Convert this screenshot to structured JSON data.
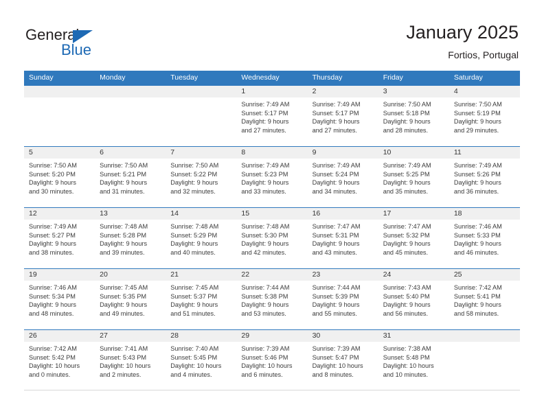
{
  "brand": {
    "name_primary": "General",
    "name_secondary": "Blue",
    "accent_color": "#1d69b4"
  },
  "header": {
    "title": "January 2025",
    "subtitle": "Fortios, Portugal"
  },
  "theme": {
    "header_blue": "#3079bd",
    "daynum_band": "#f0f0f0",
    "text": "#231f20"
  },
  "weekdays": [
    "Sunday",
    "Monday",
    "Tuesday",
    "Wednesday",
    "Thursday",
    "Friday",
    "Saturday"
  ],
  "weeks": [
    [
      {
        "day": "",
        "sunrise": "",
        "sunset": "",
        "daylight_line1": "",
        "daylight_line2": ""
      },
      {
        "day": "",
        "sunrise": "",
        "sunset": "",
        "daylight_line1": "",
        "daylight_line2": ""
      },
      {
        "day": "",
        "sunrise": "",
        "sunset": "",
        "daylight_line1": "",
        "daylight_line2": ""
      },
      {
        "day": "1",
        "sunrise": "Sunrise: 7:49 AM",
        "sunset": "Sunset: 5:17 PM",
        "daylight_line1": "Daylight: 9 hours",
        "daylight_line2": "and 27 minutes."
      },
      {
        "day": "2",
        "sunrise": "Sunrise: 7:49 AM",
        "sunset": "Sunset: 5:17 PM",
        "daylight_line1": "Daylight: 9 hours",
        "daylight_line2": "and 27 minutes."
      },
      {
        "day": "3",
        "sunrise": "Sunrise: 7:50 AM",
        "sunset": "Sunset: 5:18 PM",
        "daylight_line1": "Daylight: 9 hours",
        "daylight_line2": "and 28 minutes."
      },
      {
        "day": "4",
        "sunrise": "Sunrise: 7:50 AM",
        "sunset": "Sunset: 5:19 PM",
        "daylight_line1": "Daylight: 9 hours",
        "daylight_line2": "and 29 minutes."
      }
    ],
    [
      {
        "day": "5",
        "sunrise": "Sunrise: 7:50 AM",
        "sunset": "Sunset: 5:20 PM",
        "daylight_line1": "Daylight: 9 hours",
        "daylight_line2": "and 30 minutes."
      },
      {
        "day": "6",
        "sunrise": "Sunrise: 7:50 AM",
        "sunset": "Sunset: 5:21 PM",
        "daylight_line1": "Daylight: 9 hours",
        "daylight_line2": "and 31 minutes."
      },
      {
        "day": "7",
        "sunrise": "Sunrise: 7:50 AM",
        "sunset": "Sunset: 5:22 PM",
        "daylight_line1": "Daylight: 9 hours",
        "daylight_line2": "and 32 minutes."
      },
      {
        "day": "8",
        "sunrise": "Sunrise: 7:49 AM",
        "sunset": "Sunset: 5:23 PM",
        "daylight_line1": "Daylight: 9 hours",
        "daylight_line2": "and 33 minutes."
      },
      {
        "day": "9",
        "sunrise": "Sunrise: 7:49 AM",
        "sunset": "Sunset: 5:24 PM",
        "daylight_line1": "Daylight: 9 hours",
        "daylight_line2": "and 34 minutes."
      },
      {
        "day": "10",
        "sunrise": "Sunrise: 7:49 AM",
        "sunset": "Sunset: 5:25 PM",
        "daylight_line1": "Daylight: 9 hours",
        "daylight_line2": "and 35 minutes."
      },
      {
        "day": "11",
        "sunrise": "Sunrise: 7:49 AM",
        "sunset": "Sunset: 5:26 PM",
        "daylight_line1": "Daylight: 9 hours",
        "daylight_line2": "and 36 minutes."
      }
    ],
    [
      {
        "day": "12",
        "sunrise": "Sunrise: 7:49 AM",
        "sunset": "Sunset: 5:27 PM",
        "daylight_line1": "Daylight: 9 hours",
        "daylight_line2": "and 38 minutes."
      },
      {
        "day": "13",
        "sunrise": "Sunrise: 7:48 AM",
        "sunset": "Sunset: 5:28 PM",
        "daylight_line1": "Daylight: 9 hours",
        "daylight_line2": "and 39 minutes."
      },
      {
        "day": "14",
        "sunrise": "Sunrise: 7:48 AM",
        "sunset": "Sunset: 5:29 PM",
        "daylight_line1": "Daylight: 9 hours",
        "daylight_line2": "and 40 minutes."
      },
      {
        "day": "15",
        "sunrise": "Sunrise: 7:48 AM",
        "sunset": "Sunset: 5:30 PM",
        "daylight_line1": "Daylight: 9 hours",
        "daylight_line2": "and 42 minutes."
      },
      {
        "day": "16",
        "sunrise": "Sunrise: 7:47 AM",
        "sunset": "Sunset: 5:31 PM",
        "daylight_line1": "Daylight: 9 hours",
        "daylight_line2": "and 43 minutes."
      },
      {
        "day": "17",
        "sunrise": "Sunrise: 7:47 AM",
        "sunset": "Sunset: 5:32 PM",
        "daylight_line1": "Daylight: 9 hours",
        "daylight_line2": "and 45 minutes."
      },
      {
        "day": "18",
        "sunrise": "Sunrise: 7:46 AM",
        "sunset": "Sunset: 5:33 PM",
        "daylight_line1": "Daylight: 9 hours",
        "daylight_line2": "and 46 minutes."
      }
    ],
    [
      {
        "day": "19",
        "sunrise": "Sunrise: 7:46 AM",
        "sunset": "Sunset: 5:34 PM",
        "daylight_line1": "Daylight: 9 hours",
        "daylight_line2": "and 48 minutes."
      },
      {
        "day": "20",
        "sunrise": "Sunrise: 7:45 AM",
        "sunset": "Sunset: 5:35 PM",
        "daylight_line1": "Daylight: 9 hours",
        "daylight_line2": "and 49 minutes."
      },
      {
        "day": "21",
        "sunrise": "Sunrise: 7:45 AM",
        "sunset": "Sunset: 5:37 PM",
        "daylight_line1": "Daylight: 9 hours",
        "daylight_line2": "and 51 minutes."
      },
      {
        "day": "22",
        "sunrise": "Sunrise: 7:44 AM",
        "sunset": "Sunset: 5:38 PM",
        "daylight_line1": "Daylight: 9 hours",
        "daylight_line2": "and 53 minutes."
      },
      {
        "day": "23",
        "sunrise": "Sunrise: 7:44 AM",
        "sunset": "Sunset: 5:39 PM",
        "daylight_line1": "Daylight: 9 hours",
        "daylight_line2": "and 55 minutes."
      },
      {
        "day": "24",
        "sunrise": "Sunrise: 7:43 AM",
        "sunset": "Sunset: 5:40 PM",
        "daylight_line1": "Daylight: 9 hours",
        "daylight_line2": "and 56 minutes."
      },
      {
        "day": "25",
        "sunrise": "Sunrise: 7:42 AM",
        "sunset": "Sunset: 5:41 PM",
        "daylight_line1": "Daylight: 9 hours",
        "daylight_line2": "and 58 minutes."
      }
    ],
    [
      {
        "day": "26",
        "sunrise": "Sunrise: 7:42 AM",
        "sunset": "Sunset: 5:42 PM",
        "daylight_line1": "Daylight: 10 hours",
        "daylight_line2": "and 0 minutes."
      },
      {
        "day": "27",
        "sunrise": "Sunrise: 7:41 AM",
        "sunset": "Sunset: 5:43 PM",
        "daylight_line1": "Daylight: 10 hours",
        "daylight_line2": "and 2 minutes."
      },
      {
        "day": "28",
        "sunrise": "Sunrise: 7:40 AM",
        "sunset": "Sunset: 5:45 PM",
        "daylight_line1": "Daylight: 10 hours",
        "daylight_line2": "and 4 minutes."
      },
      {
        "day": "29",
        "sunrise": "Sunrise: 7:39 AM",
        "sunset": "Sunset: 5:46 PM",
        "daylight_line1": "Daylight: 10 hours",
        "daylight_line2": "and 6 minutes."
      },
      {
        "day": "30",
        "sunrise": "Sunrise: 7:39 AM",
        "sunset": "Sunset: 5:47 PM",
        "daylight_line1": "Daylight: 10 hours",
        "daylight_line2": "and 8 minutes."
      },
      {
        "day": "31",
        "sunrise": "Sunrise: 7:38 AM",
        "sunset": "Sunset: 5:48 PM",
        "daylight_line1": "Daylight: 10 hours",
        "daylight_line2": "and 10 minutes."
      },
      {
        "day": "",
        "sunrise": "",
        "sunset": "",
        "daylight_line1": "",
        "daylight_line2": ""
      }
    ]
  ]
}
